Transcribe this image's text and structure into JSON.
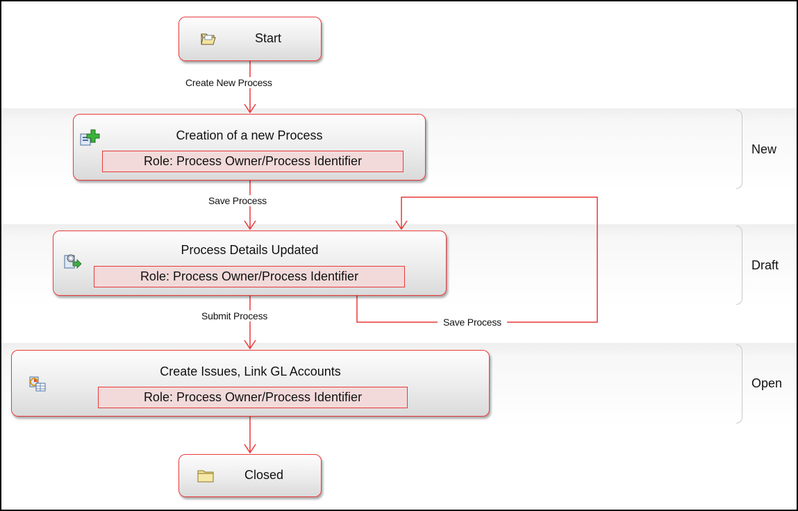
{
  "nodes": {
    "start": {
      "title": "Start",
      "icon": "folder-open-icon"
    },
    "creation": {
      "title": "Creation of a new Process",
      "role": "Role: Process Owner/Process Identifier",
      "icon": "add-document-icon"
    },
    "details": {
      "title": "Process Details Updated",
      "role": "Role: Process Owner/Process Identifier",
      "icon": "gear-document-icon"
    },
    "create_issues": {
      "title": "Create Issues, Link GL Accounts",
      "role": "Role: Process Owner/Process Identifier",
      "icon": "chart-table-icon"
    },
    "closed": {
      "title": "Closed",
      "icon": "folder-icon"
    }
  },
  "edges": {
    "create_new_process": "Create New Process",
    "save_process_1": "Save Process",
    "submit_process": "Submit Process",
    "save_process_loop": "Save Process"
  },
  "stages": {
    "new": "New",
    "draft": "Draft",
    "open": "Open"
  },
  "colors": {
    "accent_red": "#e8393a",
    "role_fill": "#f2dada",
    "node_fill_top": "#fdfdfd",
    "node_fill_bottom": "#dadada",
    "band_gray": "#eeeeee"
  }
}
